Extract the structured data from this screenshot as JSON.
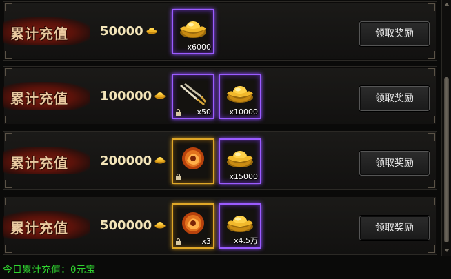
{
  "rows": [
    {
      "label": "累计充值",
      "amount": "50000",
      "button": "领取奖励",
      "rewards": [
        {
          "type": "gold-ingot",
          "quantity": "x6000",
          "frame": "purple",
          "locked": false
        }
      ]
    },
    {
      "label": "累计充值",
      "amount": "100000",
      "button": "领取奖励",
      "rewards": [
        {
          "type": "twin-blades",
          "quantity": "x50",
          "frame": "purple",
          "locked": true
        },
        {
          "type": "gold-ingot",
          "quantity": "x10000",
          "frame": "purple",
          "locked": false
        }
      ]
    },
    {
      "label": "累计充值",
      "amount": "200000",
      "button": "领取奖励",
      "rewards": [
        {
          "type": "flame-orb",
          "quantity": "",
          "frame": "gold",
          "locked": true
        },
        {
          "type": "gold-ingot",
          "quantity": "x15000",
          "frame": "purple",
          "locked": false
        }
      ]
    },
    {
      "label": "累计充值",
      "amount": "500000",
      "button": "领取奖励",
      "rewards": [
        {
          "type": "flame-orb",
          "quantity": "x3",
          "frame": "gold",
          "locked": true
        },
        {
          "type": "gold-ingot",
          "quantity": "x4.5万",
          "frame": "purple",
          "locked": false
        }
      ]
    }
  ],
  "footer": {
    "today_recharge": "今日累计充值：0元宝"
  },
  "colors": {
    "accent_gold": "#e0a828",
    "accent_purple": "#9b5cff",
    "footer_text": "#2fd32f"
  },
  "icons": {
    "currency": "yuanbao-icon",
    "lock": "lock-icon"
  }
}
